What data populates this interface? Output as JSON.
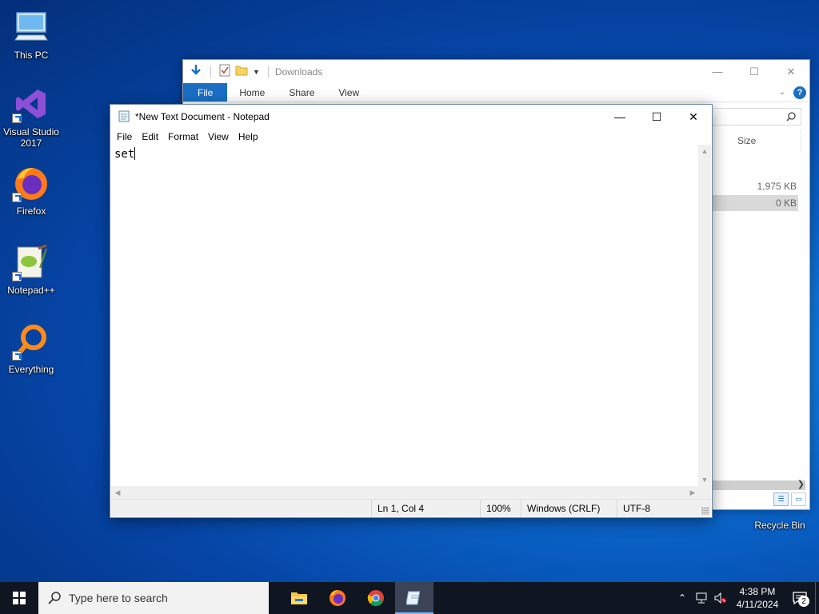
{
  "desktop": {
    "icons": [
      {
        "label": "This PC",
        "icon": "computer-icon"
      },
      {
        "label": "Visual Studio 2017",
        "icon": "visual-studio-icon"
      },
      {
        "label": "Firefox",
        "icon": "firefox-icon"
      },
      {
        "label": "Notepad++",
        "icon": "notepadpp-icon"
      },
      {
        "label": "Everything",
        "icon": "everything-icon"
      },
      {
        "label": "Recycle Bin",
        "icon": "recycle-bin-icon"
      }
    ]
  },
  "explorer": {
    "title": "Downloads",
    "ribbon_tabs": [
      "File",
      "Home",
      "Share",
      "View"
    ],
    "column_header": "Size",
    "rows": [
      "1,975 KB",
      "0 KB"
    ],
    "help": "?"
  },
  "notepad": {
    "title": "*New Text Document - Notepad",
    "menu": [
      "File",
      "Edit",
      "Format",
      "View",
      "Help"
    ],
    "content": "set",
    "status": {
      "position": "Ln 1, Col 4",
      "zoom": "100%",
      "line_ending": "Windows (CRLF)",
      "encoding": "UTF-8"
    }
  },
  "taskbar": {
    "search_placeholder": "Type here to search",
    "apps": [
      "file-explorer-icon",
      "firefox-icon",
      "chrome-icon",
      "notepad-icon"
    ],
    "time": "4:38 PM",
    "date": "4/11/2024",
    "notification_count": "2"
  },
  "colors": {
    "accent": "#1a6fc4",
    "taskbar": "#101621"
  }
}
